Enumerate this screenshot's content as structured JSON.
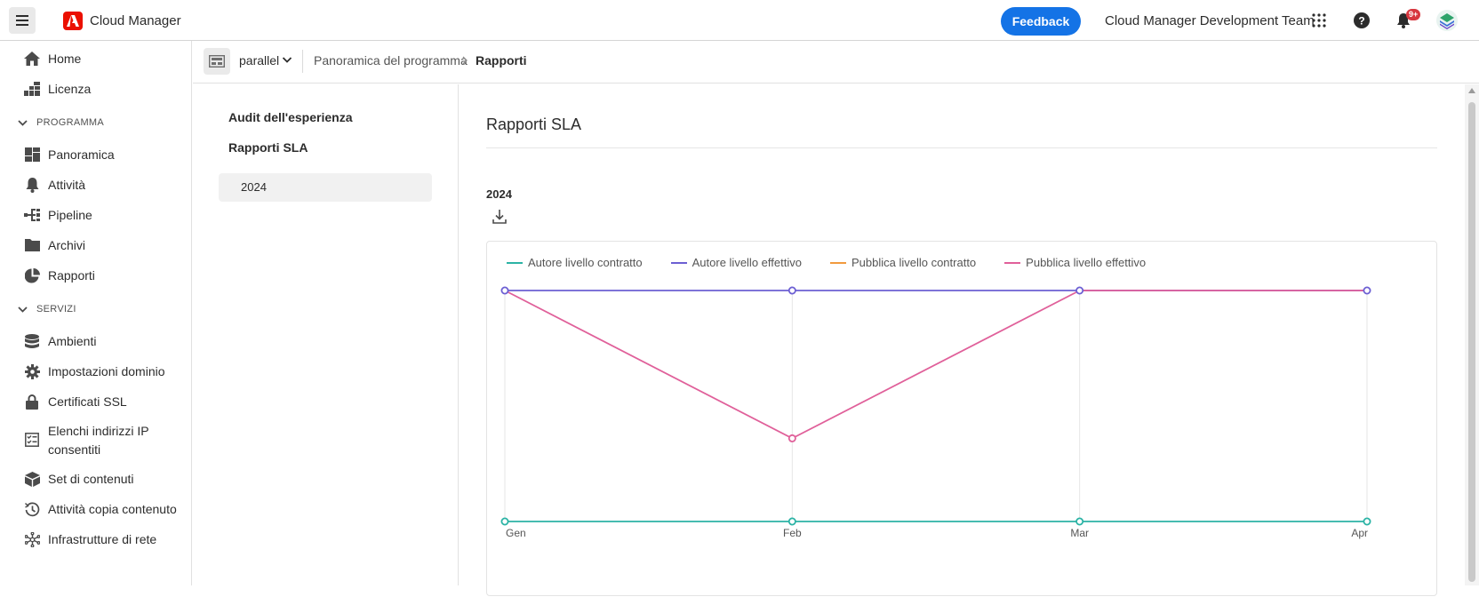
{
  "header": {
    "menu_icon": "hamburger-icon",
    "logo_icon": "adobe-logo",
    "app_title": "Cloud Manager",
    "feedback_label": "Feedback",
    "org_name": "Cloud Manager Development Team",
    "apps_icon": "apps-grid-icon",
    "help_icon": "help-icon",
    "notifications_icon": "bell-icon",
    "notifications_badge": "9+",
    "avatar_icon": "avatar"
  },
  "sidebar": {
    "top_items": [
      {
        "label": "Home",
        "icon": "home-icon"
      },
      {
        "label": "Licenza",
        "icon": "license-icon"
      }
    ],
    "sections": [
      {
        "title": "PROGRAMMA",
        "items": [
          {
            "label": "Panoramica",
            "icon": "dashboard-icon"
          },
          {
            "label": "Attività",
            "icon": "bell-icon"
          },
          {
            "label": "Pipeline",
            "icon": "pipeline-icon"
          },
          {
            "label": "Archivi",
            "icon": "folder-icon"
          },
          {
            "label": "Rapporti",
            "icon": "pie-chart-icon"
          }
        ]
      },
      {
        "title": "SERVIZI",
        "items": [
          {
            "label": "Ambienti",
            "icon": "database-icon"
          },
          {
            "label": "Impostazioni dominio",
            "icon": "gear-icon"
          },
          {
            "label": "Certificati SSL",
            "icon": "lock-icon"
          },
          {
            "label": "Elenchi indirizzi IP consentiti",
            "icon": "checklist-icon"
          },
          {
            "label": "Set di contenuti",
            "icon": "box-icon"
          },
          {
            "label": "Attività copia contenuto",
            "icon": "history-icon"
          },
          {
            "label": "Infrastrutture di rete",
            "icon": "network-icon"
          }
        ]
      }
    ]
  },
  "breadcrumb": {
    "program_name": "parallel",
    "items": [
      "Panoramica del programma",
      "Rapporti"
    ]
  },
  "subnav": {
    "items": [
      "Audit dell'esperienza",
      "Rapporti SLA"
    ],
    "selected": "2024"
  },
  "main": {
    "title": "Rapporti SLA",
    "year": "2024",
    "download_icon": "download-icon"
  },
  "colors": {
    "autore_contratto": "#2bb3a5",
    "autore_effettivo": "#6c5fd3",
    "pubblica_contratto": "#f19a3e",
    "pubblica_effettivo": "#e0609a",
    "accent": "#1473e6"
  },
  "chart_data": {
    "type": "line",
    "categories": [
      "Gen",
      "Feb",
      "Mar",
      "Apr"
    ],
    "series": [
      {
        "name": "Autore livello contratto",
        "values": [
          0,
          0,
          0,
          0
        ]
      },
      {
        "name": "Autore livello effettivo",
        "values": [
          1,
          1,
          1,
          1
        ]
      },
      {
        "name": "Pubblica livello contratto",
        "values": [
          null,
          null,
          null,
          null
        ]
      },
      {
        "name": "Pubblica livello effettivo",
        "values": [
          1,
          0.36,
          1,
          1
        ]
      }
    ],
    "ylim": [
      0,
      1
    ],
    "grid": "vertical",
    "legend": "top-left"
  }
}
